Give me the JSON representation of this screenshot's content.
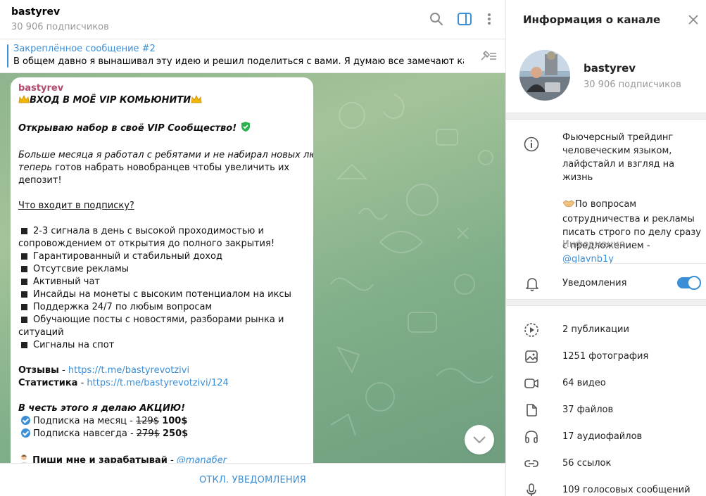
{
  "chat": {
    "title": "bastyrev",
    "subscribers": "30 906 подписчиков"
  },
  "pinned": {
    "title": "Закреплённое сообщение #2",
    "text": "В общем давно я вынашивал эту идею и решил поделиться с вами.  Я думаю все замечают как силь..."
  },
  "message": {
    "author": "bastyrev",
    "headline": "ВХОД В  МОЁ VIP КОМЬЮНИТИ",
    "open_line": "Открываю набор в своё VIP Сообщество!",
    "intro_italic_1": "Больше месяца я работал с ребятами и не набирал новых людей и",
    "intro_italic_2": "теперь",
    "intro_rest_2": " готов набрать новобранцев чтобы увеличить их",
    "intro_3": "депозит!",
    "whats_in": "Что входит в подписку?",
    "items": [
      "2-3 сигнала в день с высокой проходимостью и",
      "сопровождением от открытия до полного закрытия!",
      "Гарантированный и стабильный доход",
      "Отсутсвие рекламы",
      "Активный чат",
      "Инсайды на монеты с высоким потенциалом на иксы",
      "Поддержка 24/7 по любым вопросам",
      "Обучающие посты с новостями, разборами рынка и",
      "ситуаций",
      "Сигналы на спот"
    ],
    "reviews_label": "Отзывы",
    "reviews_link": "https://t.me/bastyrevotzivi",
    "stats_label": "Статистика",
    "stats_link": "https://t.me/bastyrevotzivi/124",
    "promo_title": "В честь этого я делаю АКЦИЮ!",
    "offer_month_label": "Подписка на месяц - ",
    "offer_month_old": "129$",
    "offer_month_new": "100$",
    "offer_forever_label": "Подписка навсегда - ",
    "offer_forever_old": "279$",
    "offer_forever_new": "250$",
    "cta": "Пиши мне и зарабатывай",
    "cta_sep": " - ",
    "cta_contact": "@manaбer"
  },
  "footer": {
    "mute_button": "ОТКЛ. УВЕДОМЛЕНИЯ"
  },
  "side": {
    "title": "Информация о канале",
    "name": "bastyrev",
    "subscribers": "30 906 подписчиков",
    "about_1": "Фьючерсный трейдинг человеческим языком, лайфстайл и взгляд на жизнь",
    "about_2": "По вопросам сотрудничества и рекламы писать строго по делу сразу с предложением - ",
    "about_contact": "@glavnb1y",
    "info_label": "Информация",
    "notifications_label": "Уведомления",
    "notifications_on": true,
    "stats": [
      {
        "icon": "posts-icon",
        "label": "2 публикации"
      },
      {
        "icon": "photo-icon",
        "label": "1251 фотография"
      },
      {
        "icon": "video-icon",
        "label": "64 видео"
      },
      {
        "icon": "file-icon",
        "label": "37 файлов"
      },
      {
        "icon": "headphones-icon",
        "label": "17 аудиофайлов"
      },
      {
        "icon": "link-icon",
        "label": "56 ссылок"
      },
      {
        "icon": "microphone-icon",
        "label": "109 голосовых сообщений"
      }
    ]
  },
  "colors": {
    "accent": "#3a8fd6",
    "author": "#b3496b",
    "wallpaper": "#8fb48d"
  }
}
